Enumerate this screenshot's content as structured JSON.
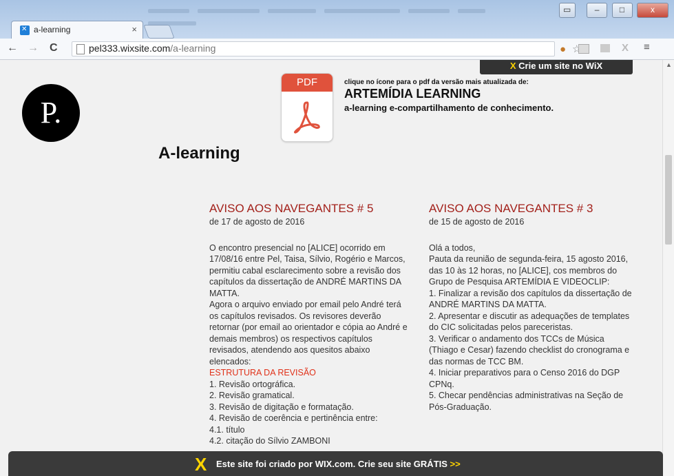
{
  "browser": {
    "tab_title": "a-learning",
    "tab_close": "×",
    "window_controls": [
      "▭",
      "–",
      "□",
      "x"
    ],
    "nav": {
      "back": "←",
      "forward": "→",
      "reload": "C"
    },
    "url_domain": "pel333.wixsite.com",
    "url_path": "/a-learning",
    "extension_icons": [
      "cookie-icon",
      "star-icon",
      "puzzle-icon",
      "extension-icon",
      "wix-icon",
      "menu-icon"
    ],
    "ext_glyphs": [
      "☆",
      "≡"
    ]
  },
  "page": {
    "logo_text": "P.",
    "wix_banner_top": "Crie um site no WiX",
    "wix_logo_glyph": "X",
    "pdf_icon_label": "PDF",
    "pdf_hint": "clique no ícone para o pdf da versão mais atualizada de:",
    "pdf_title": "ARTEMÍDIA LEARNING",
    "pdf_subtitle": "a-learning e-compartilhamento de conhecimento.",
    "heading": "A-learning",
    "columns": [
      {
        "title": "AVISO AOS NAVEGANTES # 5",
        "date": "de 17 de agosto de 2016",
        "lines": [
          "O encontro presencial no  [ALICE] ocorrido em 17/08/16 entre Pel, Taisa, Sílvio, Rogério e Marcos, permitiu cabal esclarecimento sobre a revisão dos capítulos da dissertação de ANDRÉ MARTINS DA MATTA.",
          "Agora o arquivo enviado por email pelo André terá os capítulos revisados. Os revisores deverão retornar (por email ao orientador e cópia ao André e demais membros) os respectivos capítulos revisados, atendendo aos quesitos abaixo elencados:",
          "ESTRUTURA DA REVISÃO",
          "1. Revisão ortográfica.",
          "2. Revisão gramatical.",
          "3. Revisão de digitação e formatação.",
          "4. Revisão de coerência e pertinência entre:",
          "4.1. título",
          "4.2. citação do Sílvio ZAMBONI"
        ]
      },
      {
        "title": "AVISO AOS NAVEGANTES # 3",
        "date": "de 15 de agosto de 2016",
        "lines": [
          "Olá a todos,",
          "Pauta da reunião de segunda-feira, 15 agosto 2016, das 10 às 12 horas, no [ALICE], cos membros do Grupo de Pesquisa ARTEMÍDIA E VIDEOCLIP:",
          "1. Finalizar a revisão dos capítulos da dissertação de ANDRÉ MARTINS DA MATTA.",
          "2. Apresentar e discutir as adequações de templates do CIC solicitadas pelos pareceristas.",
          "3. Verificar o andamento dos TCCs de Música (Thiago e Cesar) fazendo checklist do cronograma e das normas de TCC BM.",
          "4. Iniciar preparativos para o Censo 2016 do DGP CPNq.",
          "5. Checar pendências administrativas na Seção de Pós-Graduação."
        ]
      }
    ],
    "wix_banner_bottom": "Este site foi criado por WIX.com. Crie seu site GRÁTIS",
    "wix_banner_arrows": ">>"
  },
  "colors": {
    "accent_red": "#a3211b",
    "highlight_red": "#e0321a",
    "wix_yellow": "#ffd400"
  }
}
